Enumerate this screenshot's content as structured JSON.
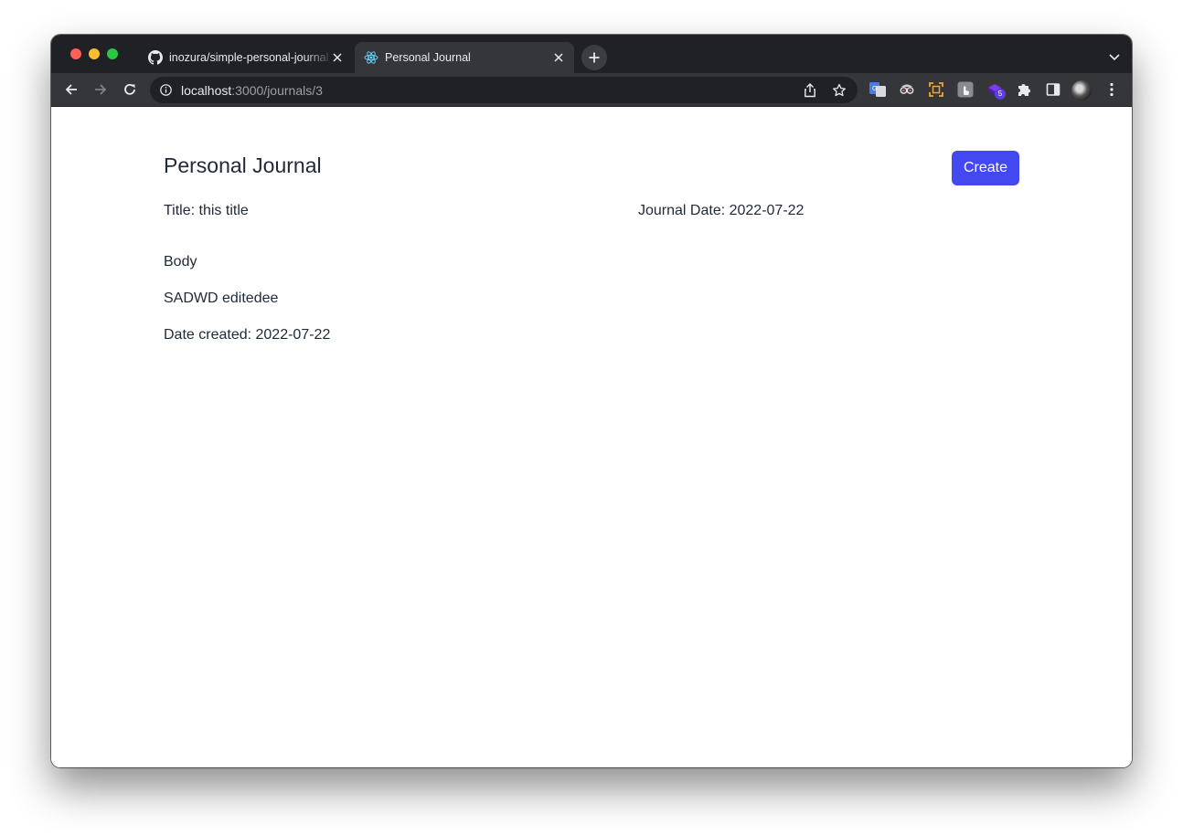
{
  "browser": {
    "tabs": [
      {
        "title": "inozura/simple-personal-journal",
        "favicon": "github-icon",
        "active": false
      },
      {
        "title": "Personal Journal",
        "favicon": "react-icon",
        "active": true
      }
    ],
    "address": {
      "host": "localhost",
      "path": ":3000/journals/3"
    },
    "extension_badge": "5"
  },
  "page": {
    "title": "Personal Journal",
    "create_label": "Create",
    "title_line": "Title: this title",
    "journal_date_line": "Journal Date: 2022-07-22",
    "body_label": "Body",
    "body_text": "SADWD editedee",
    "date_created_line": "Date created: 2022-07-22"
  },
  "colors": {
    "accent": "#4348f0",
    "chrome_dark": "#202124",
    "chrome_toolbar": "#35363a"
  }
}
